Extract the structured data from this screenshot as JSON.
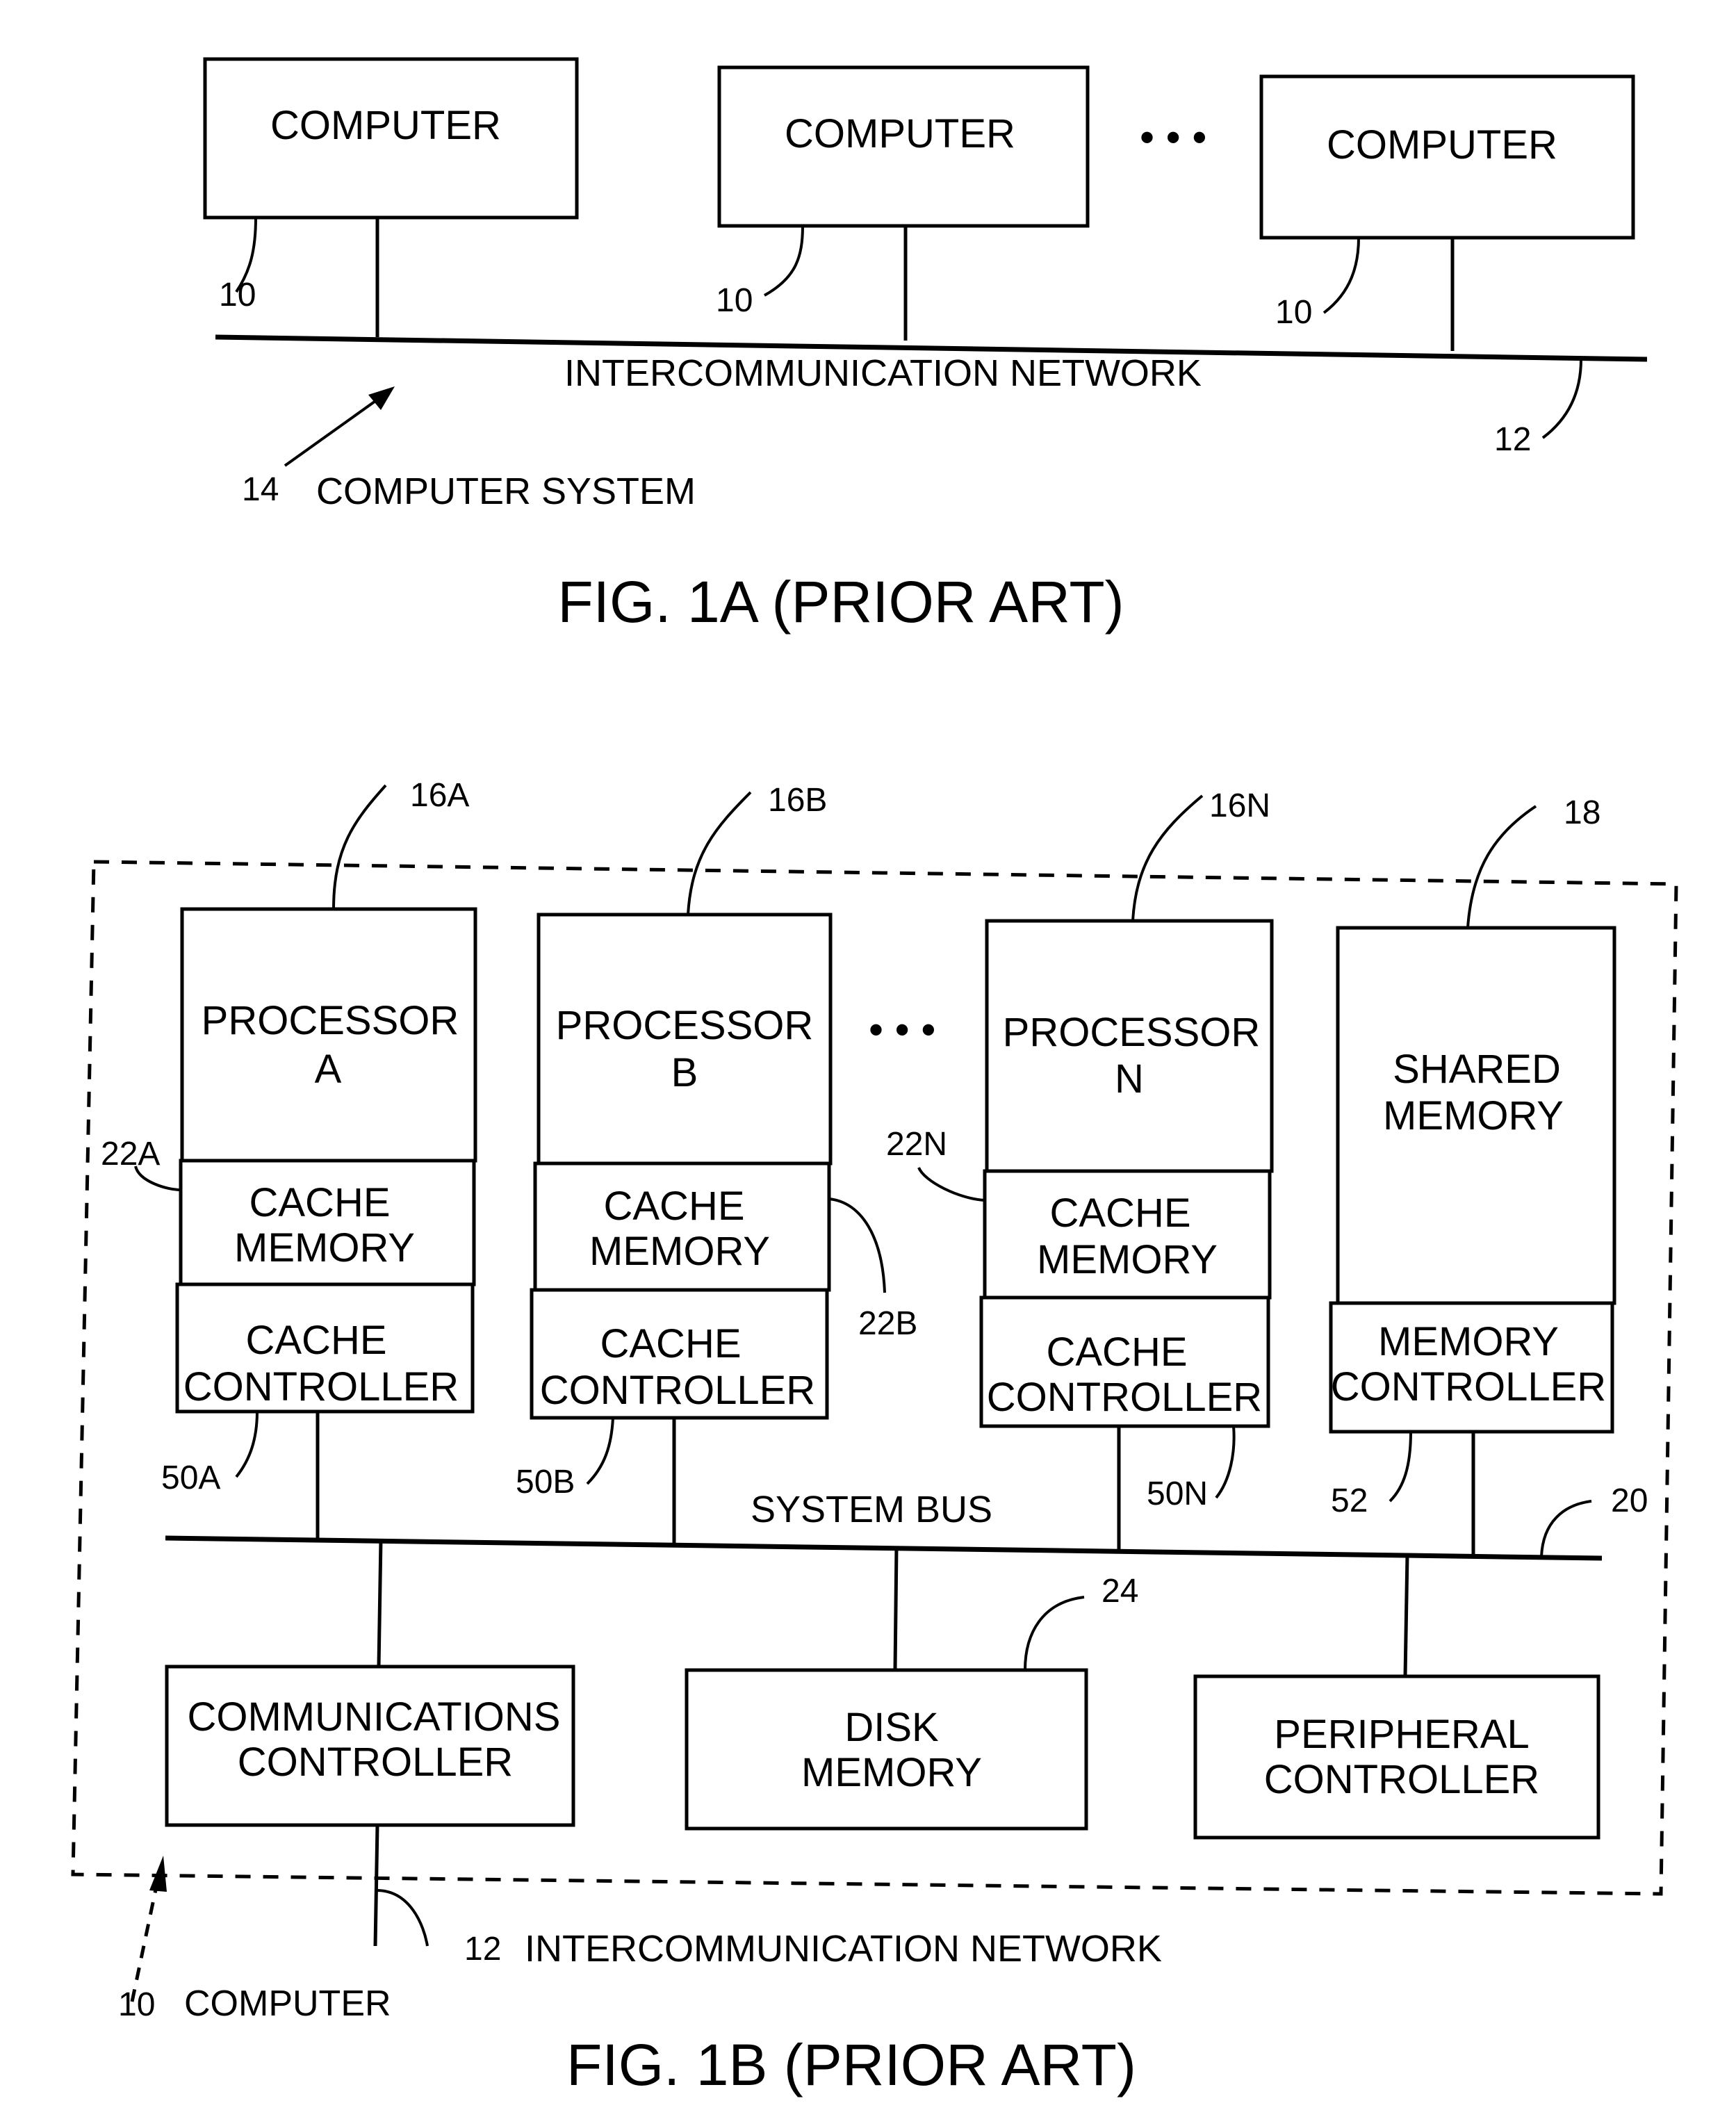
{
  "fig1a": {
    "computers": [
      {
        "label": "COMPUTER",
        "ref": "10"
      },
      {
        "label": "COMPUTER",
        "ref": "10"
      },
      {
        "label": "COMPUTER",
        "ref": "10"
      }
    ],
    "ellipsis": "• • •",
    "network_label": "INTERCOMMUNICATION NETWORK",
    "network_ref": "12",
    "system_ref": "14",
    "system_label": "COMPUTER SYSTEM",
    "caption": "FIG. 1A  (PRIOR ART)"
  },
  "fig1b": {
    "processors": [
      {
        "name": "PROCESSOR",
        "id": "A",
        "ref": "16A",
        "cache_label_1": "CACHE",
        "cache_label_2": "MEMORY",
        "cache_ref": "22A",
        "ctrl_label_1": "CACHE",
        "ctrl_label_2": "CONTROLLER",
        "ctrl_ref": "50A"
      },
      {
        "name": "PROCESSOR",
        "id": "B",
        "ref": "16B",
        "cache_label_1": "CACHE",
        "cache_label_2": "MEMORY",
        "cache_ref": "22B",
        "ctrl_label_1": "CACHE",
        "ctrl_label_2": "CONTROLLER",
        "ctrl_ref": "50B"
      },
      {
        "name": "PROCESSOR",
        "id": "N",
        "ref": "16N",
        "cache_label_1": "CACHE",
        "cache_label_2": "MEMORY",
        "cache_ref": "22N",
        "ctrl_label_1": "CACHE",
        "ctrl_label_2": "CONTROLLER",
        "ctrl_ref": "50N"
      }
    ],
    "ellipsis": "• • •",
    "shared_memory": {
      "label_1": "SHARED",
      "label_2": "MEMORY",
      "ref": "18",
      "ctrl_label_1": "MEMORY",
      "ctrl_label_2": "CONTROLLER",
      "ctrl_ref": "52"
    },
    "system_bus_label": "SYSTEM BUS",
    "system_bus_ref": "20",
    "comm_controller": {
      "label_1": "COMMUNICATIONS",
      "label_2": "CONTROLLER"
    },
    "disk_memory": {
      "label_1": "DISK",
      "label_2": "MEMORY",
      "ref": "24"
    },
    "peripheral_controller": {
      "label_1": "PERIPHERAL",
      "label_2": "CONTROLLER"
    },
    "network_ref": "12",
    "network_label": "INTERCOMMUNICATION NETWORK",
    "computer_ref": "10",
    "computer_label": "COMPUTER",
    "caption": "FIG. 1B  (PRIOR ART)"
  }
}
